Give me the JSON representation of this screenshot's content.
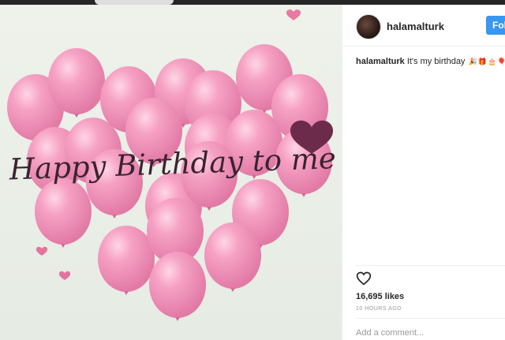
{
  "post": {
    "image_text": "Happy Birthday to me",
    "username": "halamalturk",
    "follow_label": "Follo",
    "caption_user": "halamalturk",
    "caption_text": "It's my birthday",
    "caption_emojis": [
      "🎉",
      "🎁",
      "🎂",
      "🎈",
      "❤"
    ],
    "likes": "16,695 likes",
    "time_ago": "10 HOURS AGO",
    "comment_placeholder": "Add a comment..."
  },
  "colors": {
    "accent": "#3897f0",
    "balloon": "#f08fb4",
    "text": "#262626",
    "muted": "#999999"
  },
  "icons": [
    "like-heart-icon",
    "avatar"
  ]
}
